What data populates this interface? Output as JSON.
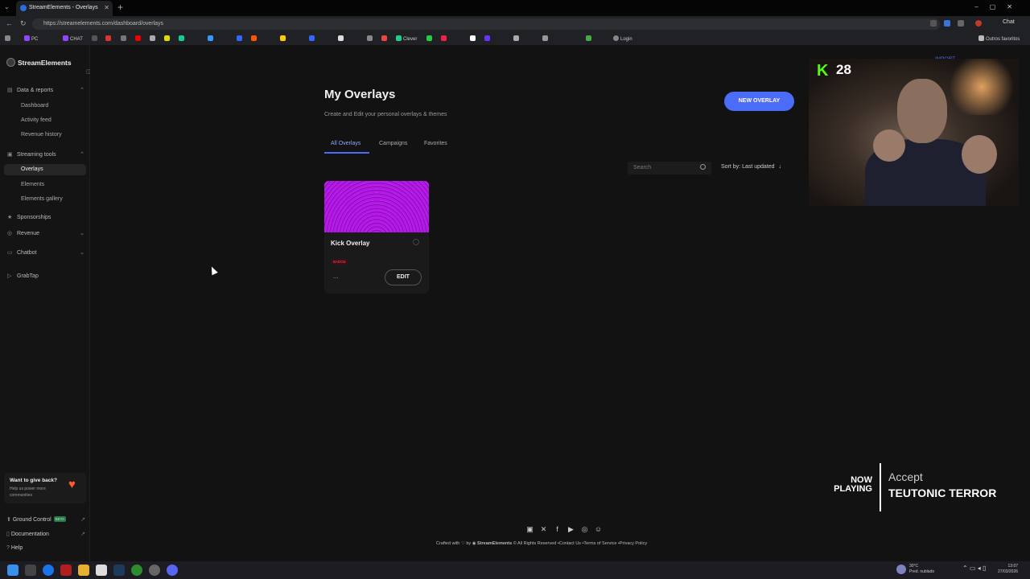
{
  "browser": {
    "tab_title": "StreamElements - Overlays",
    "url": "https://streamelements.com/dashboard/overlays",
    "chat_label": "Chat",
    "bookmarks": [
      "PC",
      "CHAT",
      "Clever",
      "Login",
      "Outros favoritos"
    ]
  },
  "sidebar": {
    "brand": "StreamElements",
    "sections": [
      {
        "label": "Data & reports",
        "items": [
          "Dashboard",
          "Activity feed",
          "Revenue history"
        ]
      },
      {
        "label": "Streaming tools",
        "items": [
          "Overlays",
          "Elements",
          "Elements gallery"
        ]
      },
      {
        "label": "Sponsorships"
      },
      {
        "label": "Revenue"
      },
      {
        "label": "Chatbot"
      },
      {
        "label": "GrabTap"
      }
    ],
    "active_item": "Overlays",
    "giveback": {
      "title": "Want to give back?",
      "subtitle": "Help us power more communities"
    },
    "footer": [
      {
        "label": "Ground Control",
        "badge": "BETA"
      },
      {
        "label": "Documentation"
      },
      {
        "label": "Help"
      }
    ]
  },
  "main": {
    "title": "My Overlays",
    "subtitle": "Create and Edit your personal overlays & themes",
    "new_overlay_label": "NEW OVERLAY",
    "import_label": "IMPORT",
    "tabs": [
      "All Overlays",
      "Campaigns",
      "Favorites"
    ],
    "search_placeholder": "Search",
    "sort_label": "Sort by: Last updated",
    "overlays": [
      {
        "name": "Kick Overlay",
        "badge": "BADGE",
        "more": "...",
        "edit_label": "EDIT"
      }
    ],
    "footer": {
      "text": "Crafted with",
      "by": "by",
      "brand": "StreamElements",
      "rights": "© All Rights Reserved",
      "links": [
        "Contact Us",
        "Terms of Service",
        "Privacy Policy"
      ]
    }
  },
  "webcam": {
    "platform_badge": "K",
    "viewer_count": "28"
  },
  "now_playing": {
    "label_line1": "NOW",
    "label_line2": "PLAYING",
    "artist": "Accept",
    "title": "TEUTONIC TERROR"
  },
  "taskbar": {
    "weather": "30°C",
    "weather_desc": "Pred. nublado",
    "time": "13:07",
    "date": "27/03/2026"
  },
  "colors": {
    "accent": "#4a6cf7",
    "kick_green": "#53fc18",
    "thumb_purple": "#b616e8"
  }
}
